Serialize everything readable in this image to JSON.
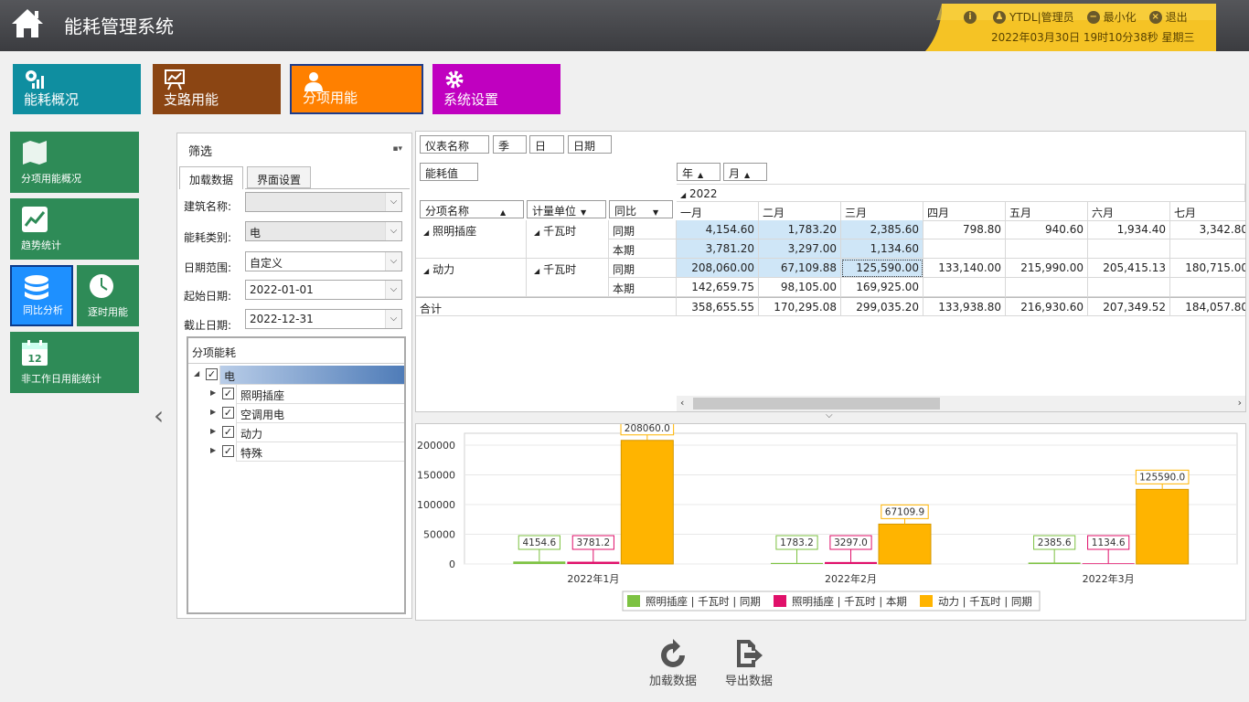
{
  "header": {
    "title": "能耗管理系统",
    "info_icon": "info-icon",
    "user": "YTDL|管理员",
    "minimize": "最小化",
    "logout": "退出",
    "datetime": "2022年03月30日 19时10分38秒 星期三"
  },
  "topnav": [
    {
      "label": "能耗概况",
      "icon": "chart-icon",
      "color": "#0f8ea0"
    },
    {
      "label": "支路用能",
      "icon": "presentation-icon",
      "color": "#8b4513"
    },
    {
      "label": "分项用能",
      "icon": "person-icon",
      "color": "#ff8000"
    },
    {
      "label": "系统设置",
      "icon": "gear-icon",
      "color": "#c000c0"
    }
  ],
  "sidebar": [
    {
      "label": "分项用能概况",
      "icon": "map-icon"
    },
    {
      "label": "趋势统计",
      "icon": "trend-icon"
    },
    {
      "label": "同比分析",
      "icon": "database-icon"
    },
    {
      "label": "逐时用能",
      "icon": "clock-icon"
    },
    {
      "label": "非工作日用能统计",
      "icon": "calendar-icon",
      "icon_text": "12"
    }
  ],
  "filter": {
    "title": "筛选",
    "tabs": [
      "加载数据",
      "界面设置"
    ],
    "fields": [
      {
        "label": "建筑名称:",
        "value": ""
      },
      {
        "label": "能耗类别:",
        "value": "电"
      },
      {
        "label": "日期范围:",
        "value": "自定义"
      },
      {
        "label": "起始日期:",
        "value": "2022-01-01"
      },
      {
        "label": "截止日期:",
        "value": "2022-12-31"
      }
    ],
    "tree_title": "分项能耗",
    "tree": [
      {
        "label": "电",
        "level": 0
      },
      {
        "label": "照明插座",
        "level": 1
      },
      {
        "label": "空调用电",
        "level": 1
      },
      {
        "label": "动力",
        "level": 1
      },
      {
        "label": "特殊",
        "level": 1
      }
    ]
  },
  "pivot": {
    "filter_fields": [
      "仪表名称",
      "季",
      "日",
      "日期"
    ],
    "data_field": "能耗值",
    "column_fields": [
      "年",
      "月"
    ],
    "row_fields": [
      "分项名称",
      "计量单位",
      "同比"
    ],
    "year": "2022",
    "months": [
      "一月",
      "二月",
      "三月",
      "四月",
      "五月",
      "六月",
      "七月"
    ],
    "rows": [
      {
        "name": "照明插座",
        "unit": "千瓦时",
        "type": "同期",
        "values": [
          "4,154.60",
          "1,783.20",
          "2,385.60",
          "798.80",
          "940.60",
          "1,934.40",
          "3,342.80"
        ]
      },
      {
        "name": "",
        "unit": "",
        "type": "本期",
        "values": [
          "3,781.20",
          "3,297.00",
          "1,134.60",
          "",
          "",
          "",
          ""
        ]
      },
      {
        "name": "动力",
        "unit": "千瓦时",
        "type": "同期",
        "values": [
          "208,060.00",
          "67,109.88",
          "125,590.00",
          "133,140.00",
          "215,990.00",
          "205,415.13",
          "180,715.00"
        ]
      },
      {
        "name": "",
        "unit": "",
        "type": "本期",
        "values": [
          "142,659.75",
          "98,105.00",
          "169,925.00",
          "",
          "",
          "",
          ""
        ]
      }
    ],
    "total_label": "合计",
    "totals": [
      "358,655.55",
      "170,295.08",
      "299,035.20",
      "133,938.80",
      "216,930.60",
      "207,349.52",
      "184,057.80"
    ]
  },
  "chart_data": {
    "type": "bar",
    "categories": [
      "2022年1月",
      "2022年2月",
      "2022年3月"
    ],
    "series": [
      {
        "name": "照明插座 | 千瓦时 | 同期",
        "color": "#7dc242",
        "values": [
          4154.6,
          1783.2,
          2385.6
        ],
        "labels": [
          "4154.6",
          "1783.2",
          "2385.6"
        ]
      },
      {
        "name": "照明插座 | 千瓦时 | 本期",
        "color": "#e0106a",
        "values": [
          3781.2,
          3297.0,
          1134.6
        ],
        "labels": [
          "3781.2",
          "3297.0",
          "1134.6"
        ]
      },
      {
        "name": "动力 | 千瓦时 | 同期",
        "color": "#ffb400",
        "values": [
          208060.0,
          67109.9,
          125590.0
        ],
        "labels": [
          "208060.0",
          "67109.9",
          "125590.0"
        ]
      }
    ],
    "yticks": [
      "0",
      "50000",
      "100000",
      "150000",
      "200000"
    ],
    "ylim": [
      0,
      220000
    ],
    "grid": true,
    "legend": "bottom"
  },
  "bottom_buttons": [
    {
      "label": "加载数据",
      "icon": "refresh-icon"
    },
    {
      "label": "导出数据",
      "icon": "export-icon"
    }
  ]
}
